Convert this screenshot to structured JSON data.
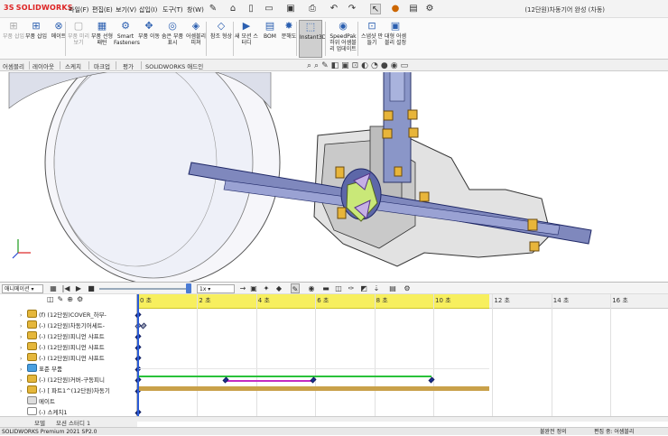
{
  "app": {
    "logo_text": "SOLIDWORKS",
    "window_title": "(12단원)차동기어 완성 (차동)"
  },
  "menu": [
    "파일(F)",
    "편집(E)",
    "보기(V)",
    "삽입(I)",
    "도구(T)",
    "창(W)"
  ],
  "commands": [
    {
      "label": "부품 삽입",
      "icon": "insert-component-icon",
      "enabled": false
    },
    {
      "label": "부품 삽입",
      "icon": "insert-component-icon",
      "enabled": true
    },
    {
      "label": "메이트",
      "icon": "mate-icon",
      "enabled": true
    },
    {
      "label": "부품 미리보기",
      "icon": "component-preview-icon",
      "enabled": false
    },
    {
      "label": "부품 선형 패턴",
      "icon": "linear-pattern-icon",
      "enabled": true
    },
    {
      "label": "Smart Fasteners",
      "icon": "smart-fasteners-icon",
      "enabled": true
    },
    {
      "label": "부품 이동",
      "icon": "move-component-icon",
      "enabled": true
    },
    {
      "label": "숨은 부품 표시",
      "icon": "show-hidden-icon",
      "enabled": true
    },
    {
      "label": "어셈블리 피쳐",
      "icon": "assembly-feature-icon",
      "enabled": true
    },
    {
      "label": "참조 형상",
      "icon": "reference-geometry-icon",
      "enabled": true
    },
    {
      "label": "새 모션 스터디",
      "icon": "new-motion-study-icon",
      "enabled": true
    },
    {
      "label": "BOM",
      "icon": "bom-icon",
      "enabled": true
    },
    {
      "label": "분해도",
      "icon": "exploded-view-icon",
      "enabled": true
    },
    {
      "label": "Instant3D",
      "icon": "instant3d-icon",
      "enabled": true,
      "active": true
    },
    {
      "label": "SpeedPak 하위 어셈블리 업데이트",
      "icon": "speedpak-icon",
      "enabled": true
    },
    {
      "label": "스냅샷 만들기",
      "icon": "snapshot-icon",
      "enabled": true
    },
    {
      "label": "대형 어셈블리 설정",
      "icon": "large-assembly-icon",
      "enabled": true
    }
  ],
  "tabs": [
    "어셈블리",
    "레이아웃",
    "스케치",
    "마크업",
    "평가",
    "SOLIDWORKS 애드인"
  ],
  "motion": {
    "study_type": "애니메이션",
    "speed_value": "1x",
    "tick_labels": [
      "0 초",
      "2 초",
      "4 초",
      "6 초",
      "8 초",
      "10 초",
      "12 초",
      "14 초",
      "16 초"
    ],
    "tree_rows": [
      {
        "label": "(f) (12단원)COVER_하부-",
        "icon": "gear"
      },
      {
        "label": "(-) (12단원)차동기어세트-",
        "icon": "gear"
      },
      {
        "label": "(-) (12단원)피니언 샤프트",
        "icon": "gear"
      },
      {
        "label": "(-) (12단원)피니언 샤프트",
        "icon": "gear"
      },
      {
        "label": "(-) (12단원)피니언 샤프트",
        "icon": "gear"
      },
      {
        "label": "표준 부품",
        "icon": "folder"
      },
      {
        "label": "(-) (12단원)커버-구동피니",
        "icon": "gear"
      },
      {
        "label": "(-) [ 파트1^(12단원)차동기",
        "icon": "gear"
      },
      {
        "label": "메이트",
        "icon": "gray"
      },
      {
        "label": "(-) 스케치1",
        "icon": "plain"
      }
    ]
  },
  "bottom_tabs": [
    "모델",
    "모션 스터디 1"
  ],
  "status": {
    "left": "SOLIDWORKS Premium 2021 SP2.0",
    "right_1": "불완전 정의",
    "right_2": "편집 중: 어셈블리"
  },
  "colors": {
    "logo_red": "#d22222",
    "timeline_header": "#f7ef5e",
    "keyframe_blue": "#1a2e8c",
    "green_bar": "#29c23a",
    "magenta_bar": "#c42bc4",
    "gold_bar": "#c9a14a"
  }
}
